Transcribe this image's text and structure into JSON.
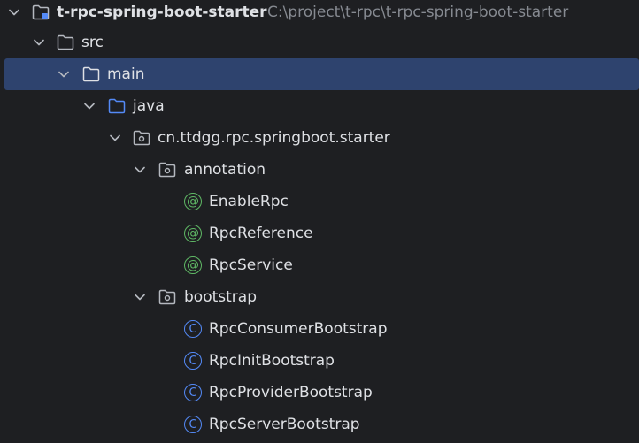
{
  "project": {
    "name": "t-rpc-spring-boot-starter",
    "path": "C:\\project\\t-rpc\\t-rpc-spring-boot-starter"
  },
  "tree": {
    "src": "src",
    "main": "main",
    "java": "java",
    "package": "cn.ttdgg.rpc.springboot.starter",
    "annotation_pkg": "annotation",
    "annotation_items": [
      "EnableRpc",
      "RpcReference",
      "RpcService"
    ],
    "bootstrap_pkg": "bootstrap",
    "bootstrap_items": [
      "RpcConsumerBootstrap",
      "RpcInitBootstrap",
      "RpcProviderBootstrap",
      "RpcServerBootstrap"
    ]
  },
  "icons": {
    "annotation_glyph": "@",
    "class_glyph": "C"
  },
  "colors": {
    "background": "#1e1f22",
    "selection": "#2e436e",
    "annotation": "#5fb865",
    "class": "#548af7",
    "source_folder": "#548af7",
    "text": "#dfe1e5",
    "path_text": "#868a91"
  }
}
